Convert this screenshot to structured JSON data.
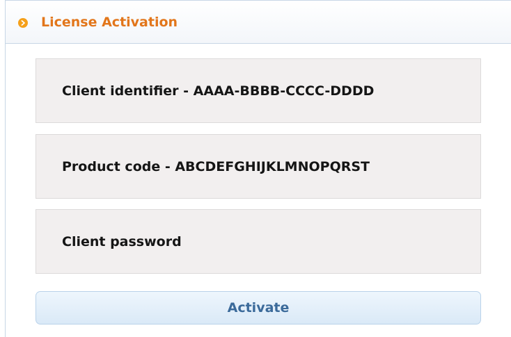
{
  "header": {
    "title": "License Activation",
    "icon": "arrow-circle-icon",
    "title_color": "#e2761b",
    "icon_color": "#f5a01a"
  },
  "fields": [
    {
      "label": "Client identifier - AAAA-BBBB-CCCC-DDDD"
    },
    {
      "label": "Product code - ABCDEFGHIJKLMNOPQRST"
    },
    {
      "label": "Client password"
    }
  ],
  "actions": {
    "activate_label": "Activate",
    "activate_color": "#3b6a9a"
  }
}
